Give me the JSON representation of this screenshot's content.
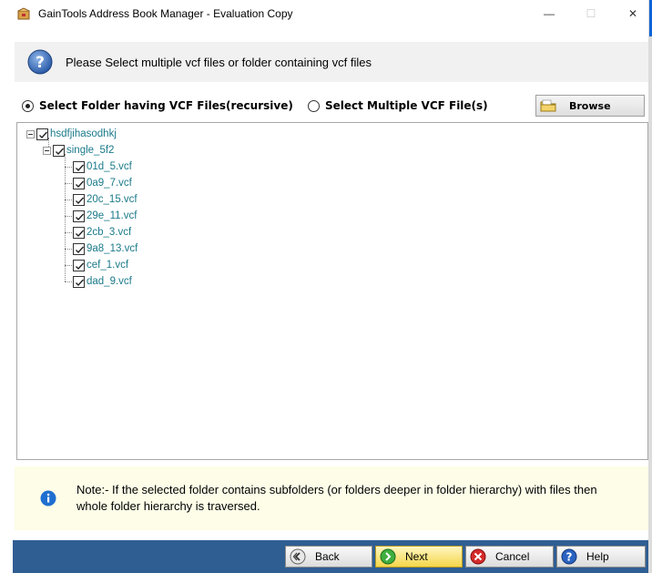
{
  "window": {
    "title": "GainTools Address Book Manager - Evaluation Copy",
    "minimize": "—",
    "maximize": "☐",
    "close": "✕"
  },
  "header": {
    "instruction": "Please Select multiple vcf files or folder containing vcf files"
  },
  "options": {
    "folder_label": "Select Folder having VCF Files(recursive)",
    "files_label": "Select Multiple VCF File(s)",
    "selected": "folder",
    "browse_label": "Browse"
  },
  "tree": {
    "root": "hsdfjihasodhkj",
    "subfolder": "single_5f2",
    "files": [
      "01d_5.vcf",
      "0a9_7.vcf",
      "20c_15.vcf",
      "29e_11.vcf",
      "2cb_3.vcf",
      "9a8_13.vcf",
      "cef_1.vcf",
      "dad_9.vcf"
    ]
  },
  "note": {
    "text": "Note:- If the selected folder contains subfolders (or folders deeper in folder hierarchy) with files then whole folder hierarchy is traversed."
  },
  "footer": {
    "back": "Back",
    "next": "Next",
    "cancel": "Cancel",
    "help": "Help"
  },
  "colors": {
    "footer_bg": "#2f5e93",
    "tree_text": "#1a7a8a",
    "note_bg": "#fdfde8",
    "next_button": "#f5d64a"
  },
  "icons": {
    "app": "app-box-icon",
    "question": "question-icon",
    "info": "info-icon",
    "folder": "folder-icon",
    "back": "back-arrow-icon",
    "next": "next-arrow-icon",
    "cancel": "cancel-icon",
    "help": "help-icon"
  }
}
